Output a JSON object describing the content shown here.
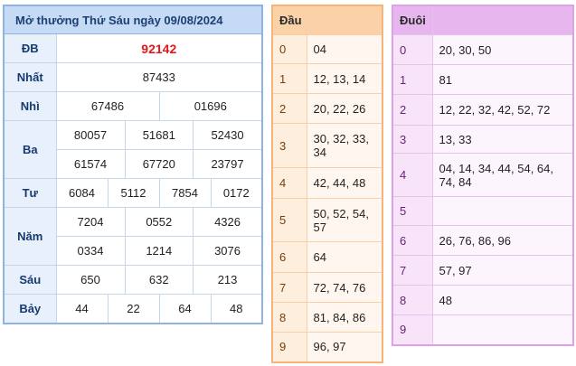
{
  "results": {
    "title": "Mở thưởng Thứ Sáu ngày 09/08/2024",
    "rows": {
      "db": {
        "label": "ĐB",
        "values": [
          "92142"
        ]
      },
      "nhat": {
        "label": "Nhất",
        "values": [
          "87433"
        ]
      },
      "nhi": {
        "label": "Nhì",
        "values": [
          "67486",
          "01696"
        ]
      },
      "ba": {
        "label": "Ba",
        "values": [
          "80057",
          "51681",
          "52430",
          "61574",
          "67720",
          "23797"
        ]
      },
      "tu": {
        "label": "Tư",
        "values": [
          "6084",
          "5112",
          "7854",
          "0172"
        ]
      },
      "nam": {
        "label": "Năm",
        "values": [
          "7204",
          "0552",
          "4326",
          "0334",
          "1214",
          "3076"
        ]
      },
      "sau": {
        "label": "Sáu",
        "values": [
          "650",
          "632",
          "213"
        ]
      },
      "bay": {
        "label": "Bảy",
        "values": [
          "44",
          "22",
          "64",
          "48"
        ]
      }
    }
  },
  "dau": {
    "title": "Đầu",
    "rows": [
      {
        "num": "0",
        "vals": "04"
      },
      {
        "num": "1",
        "vals": "12, 13, 14"
      },
      {
        "num": "2",
        "vals": "20, 22, 26"
      },
      {
        "num": "3",
        "vals": "30, 32, 33, 34"
      },
      {
        "num": "4",
        "vals": "42, 44, 48"
      },
      {
        "num": "5",
        "vals": "50, 52, 54, 57"
      },
      {
        "num": "6",
        "vals": "64"
      },
      {
        "num": "7",
        "vals": "72, 74, 76"
      },
      {
        "num": "8",
        "vals": "81, 84, 86"
      },
      {
        "num": "9",
        "vals": "96, 97"
      }
    ]
  },
  "duoi": {
    "title": "Đuôi",
    "rows": [
      {
        "num": "0",
        "vals": "20, 30, 50"
      },
      {
        "num": "1",
        "vals": "81"
      },
      {
        "num": "2",
        "vals": "12, 22, 32, 42, 52, 72"
      },
      {
        "num": "3",
        "vals": "13, 33"
      },
      {
        "num": "4",
        "vals": "04, 14, 34, 44, 54, 64, 74, 84"
      },
      {
        "num": "5",
        "vals": ""
      },
      {
        "num": "6",
        "vals": "26, 76, 86, 96"
      },
      {
        "num": "7",
        "vals": "57, 97"
      },
      {
        "num": "8",
        "vals": "48"
      },
      {
        "num": "9",
        "vals": ""
      }
    ]
  },
  "colors": {
    "special_prize": "#e3161a",
    "results_header": "#c4daf5",
    "dau_header": "#fbd2a8",
    "duoi_header": "#e8b6ee"
  }
}
